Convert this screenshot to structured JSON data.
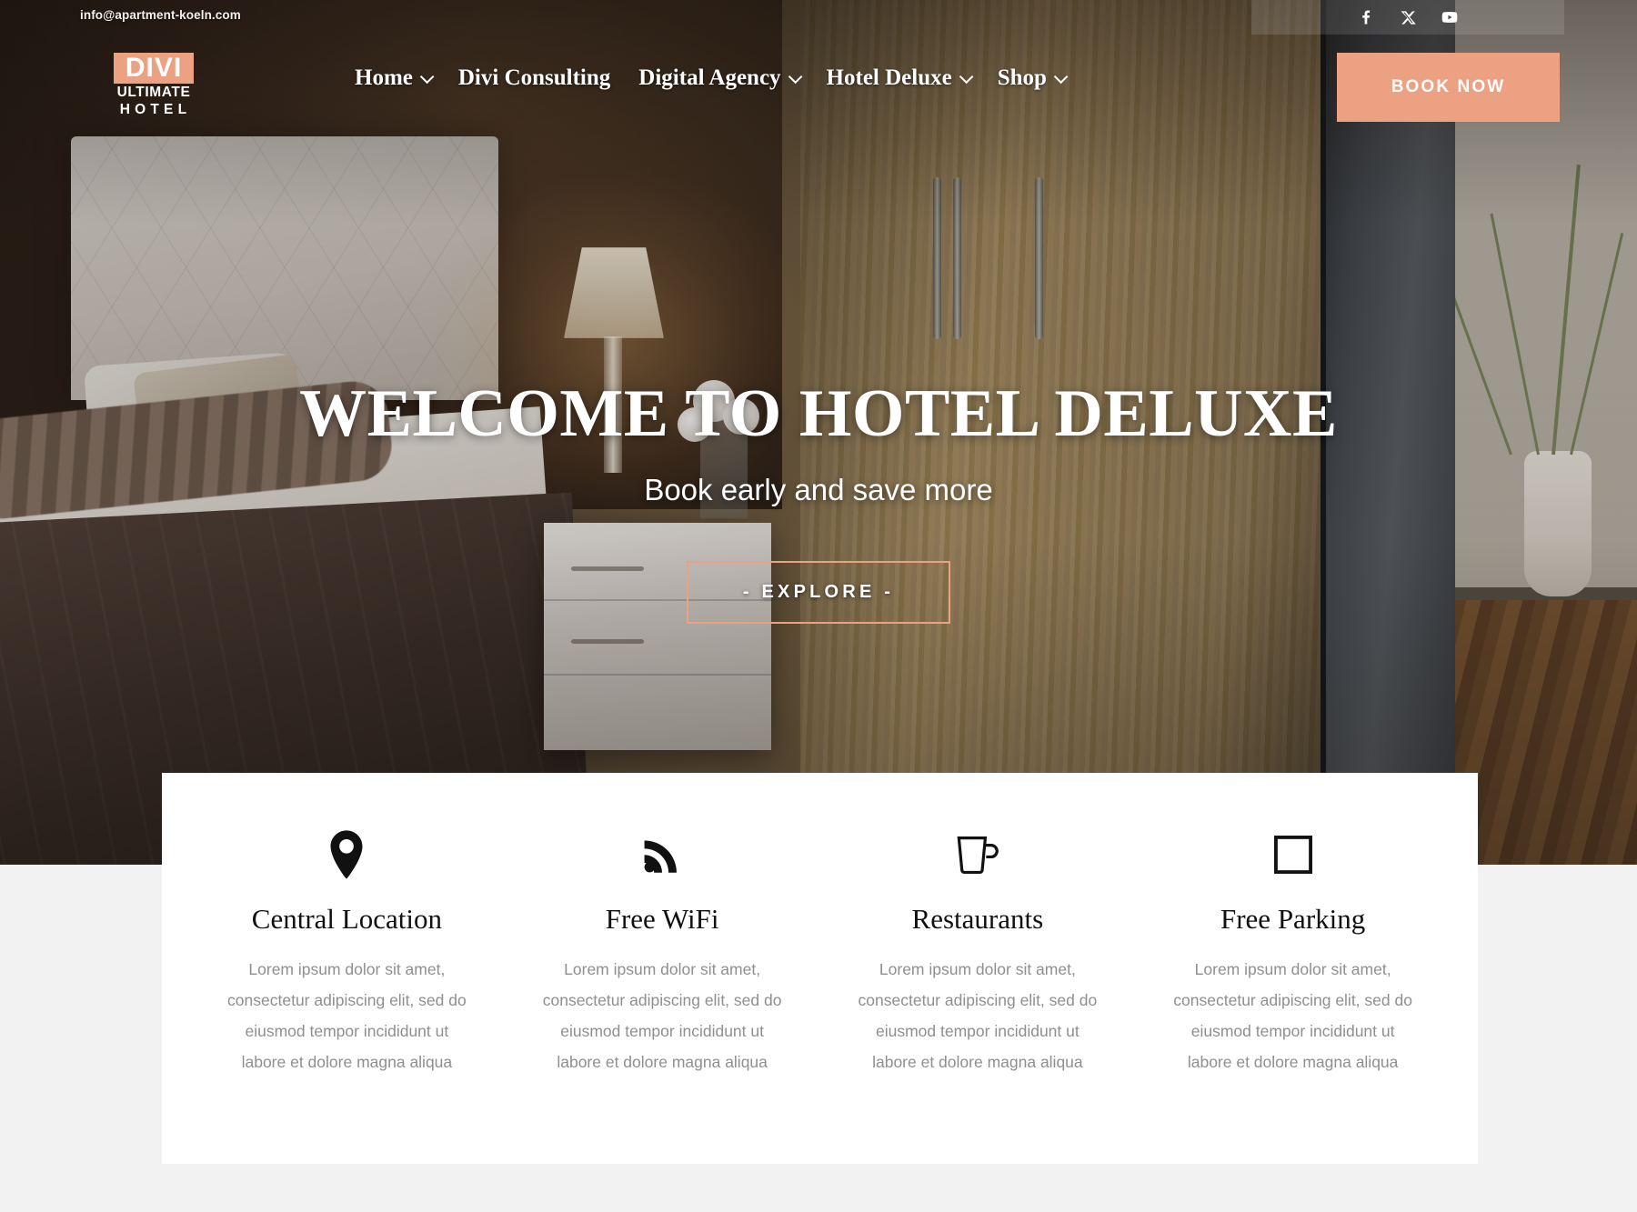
{
  "topbar": {
    "email": "info@apartment-koeln.com",
    "social": [
      {
        "name": "facebook-icon",
        "label": "Facebook"
      },
      {
        "name": "x-twitter-icon",
        "label": "X"
      },
      {
        "name": "youtube-icon",
        "label": "YouTube"
      }
    ]
  },
  "logo": {
    "line1": "DIVI",
    "line2": "ULTIMATE",
    "line3": "HOTEL"
  },
  "nav": {
    "items": [
      {
        "label": "Home",
        "has_dropdown": true
      },
      {
        "label": "Divi Consulting",
        "has_dropdown": false
      },
      {
        "label": "Digital Agency",
        "has_dropdown": true
      },
      {
        "label": "Hotel Deluxe",
        "has_dropdown": true
      },
      {
        "label": "Shop",
        "has_dropdown": true
      }
    ]
  },
  "header": {
    "book_now_label": "BOOK NOW"
  },
  "hero": {
    "title": "WELCOME TO HOTEL DELUXE",
    "subtitle": "Book early and save more",
    "cta_label": "- EXPLORE -"
  },
  "features": [
    {
      "icon": "map-pin-icon",
      "title": "Central Location",
      "text": "Lorem ipsum dolor sit amet, consectetur adipiscing elit, sed do eiusmod tempor incididunt ut labore et dolore magna aliqua"
    },
    {
      "icon": "wifi-icon",
      "title": "Free WiFi",
      "text": "Lorem ipsum dolor sit amet, consectetur adipiscing elit, sed do eiusmod tempor incididunt ut labore et dolore magna aliqua"
    },
    {
      "icon": "coffee-mug-icon",
      "title": "Restaurants",
      "text": "Lorem ipsum dolor sit amet, consectetur adipiscing elit, sed do eiusmod tempor incididunt ut labore et dolore magna aliqua"
    },
    {
      "icon": "square-outline-icon",
      "title": "Free Parking",
      "text": "Lorem ipsum dolor sit amet, consectetur adipiscing elit, sed do eiusmod tempor incididunt ut labore et dolore magna aliqua"
    }
  ],
  "colors": {
    "accent": "#eda183",
    "card_background": "#ffffff",
    "page_background": "#f2f2f2",
    "text_dark": "#111111",
    "text_muted": "#8f8f8f",
    "text_light": "#ffffff"
  }
}
